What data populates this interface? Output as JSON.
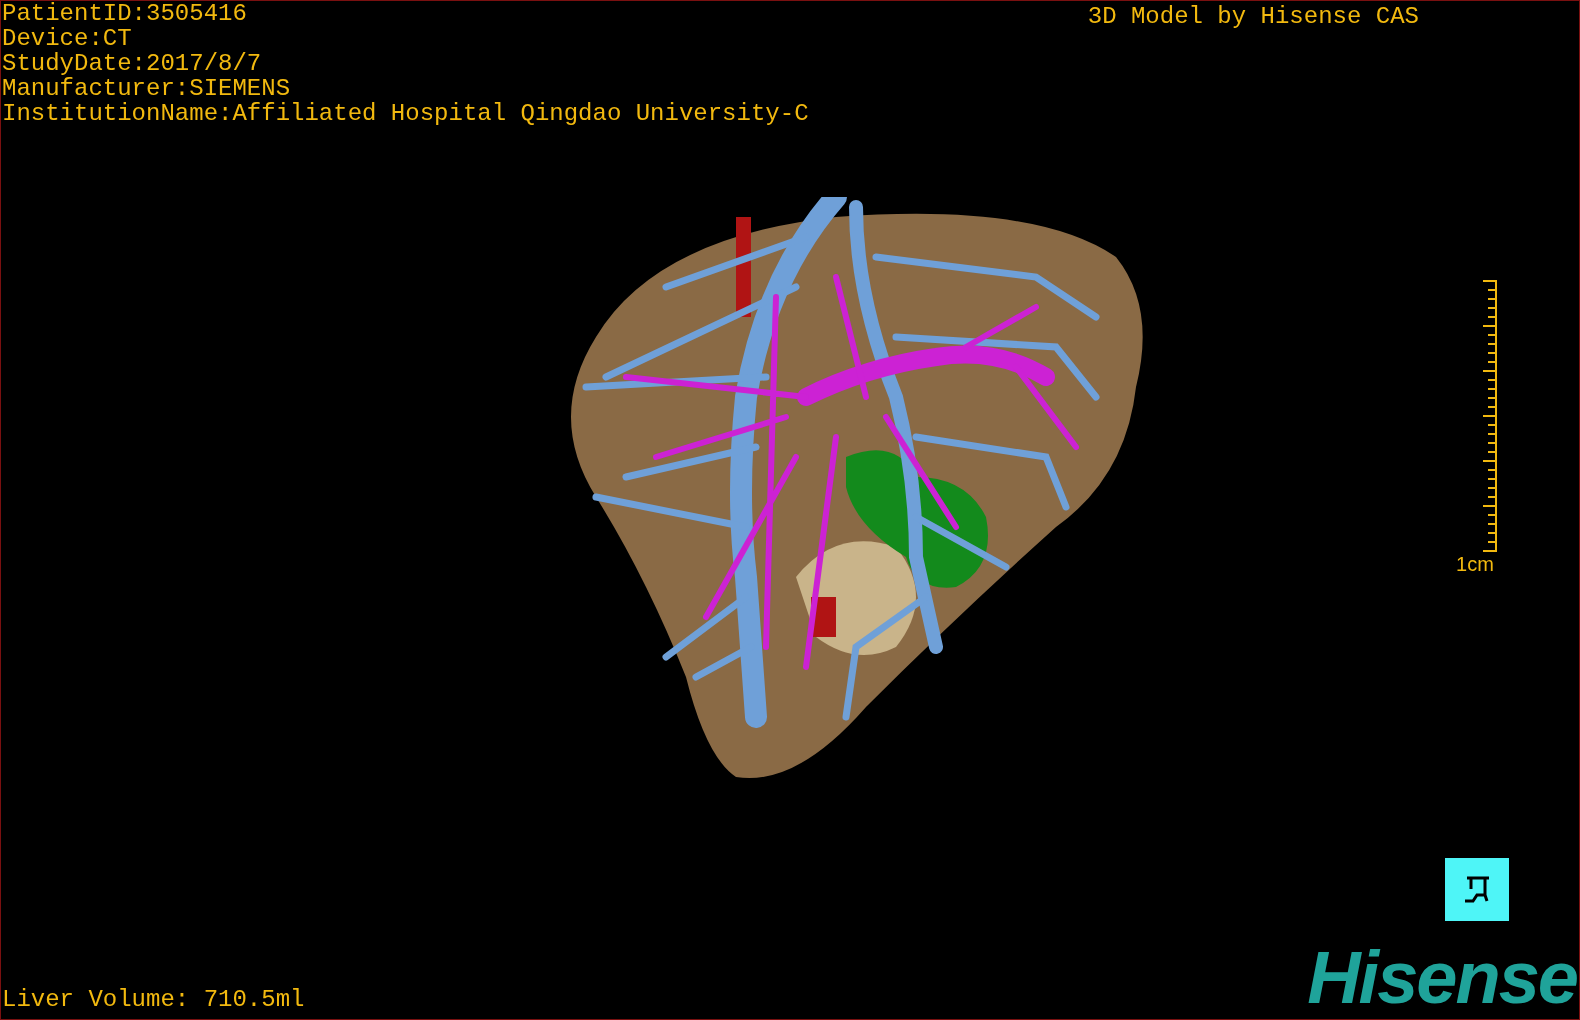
{
  "patient_info": [
    "PatientID:3505416",
    "Device:CT",
    "StudyDate:2017/8/7",
    "Manufacturer:SIEMENS",
    "InstitutionName:Affiliated Hospital Qingdao University-C"
  ],
  "title": "3D Model by Hisense CAS",
  "scale_bar": {
    "label": "1cm"
  },
  "liver_volume": "Liver Volume: 710.5ml",
  "logo": "Hisense"
}
